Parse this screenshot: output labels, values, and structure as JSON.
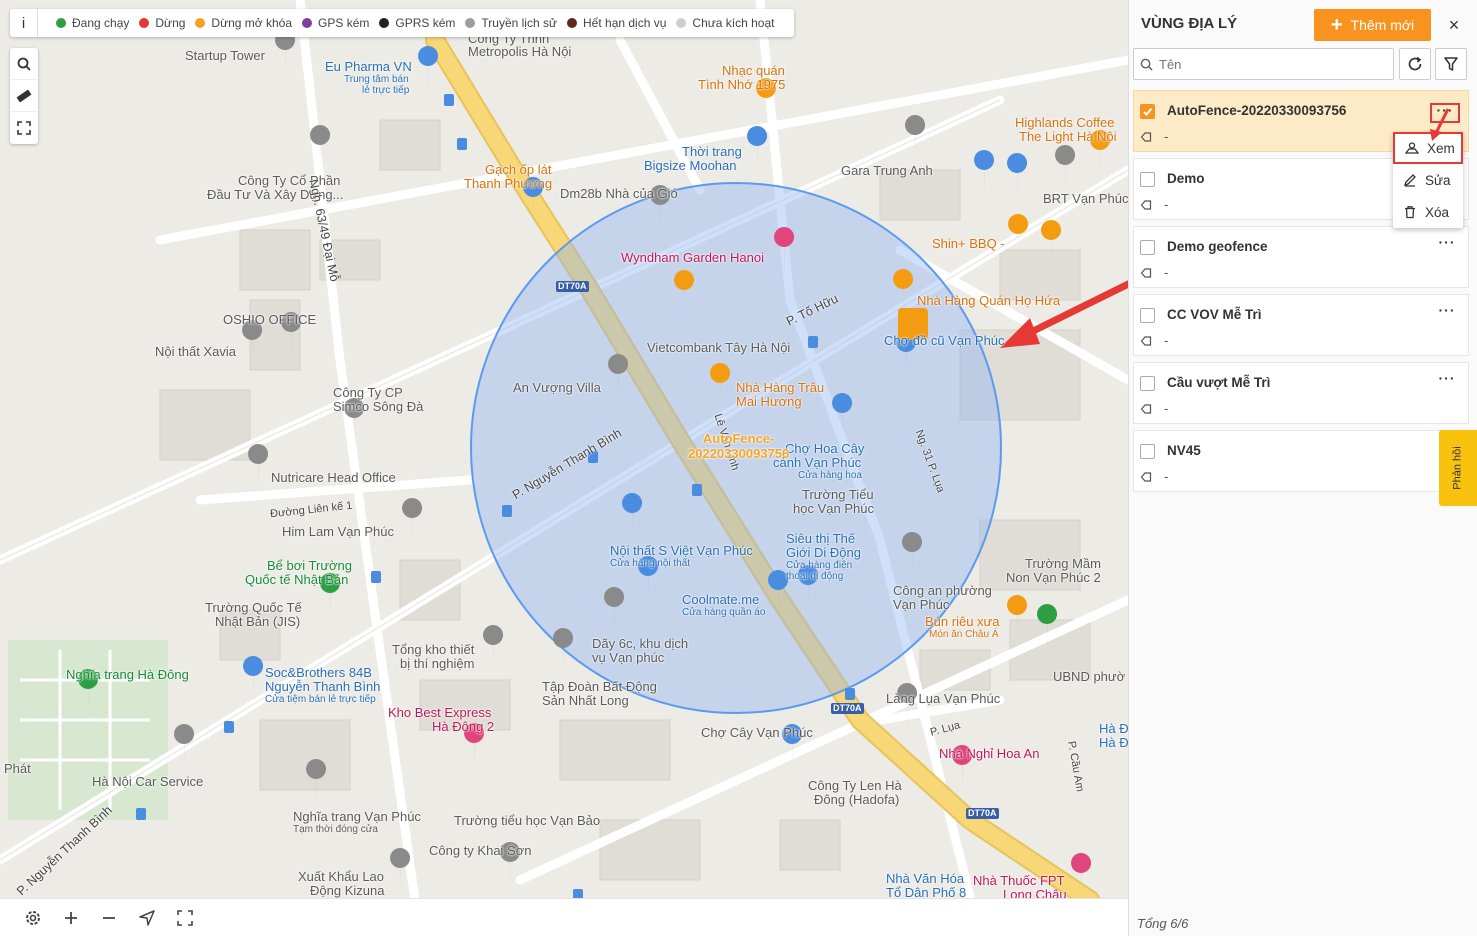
{
  "legend": {
    "info_label": "i",
    "items": [
      {
        "label": "Đang chạy",
        "color": "#2e9e44"
      },
      {
        "label": "Dừng",
        "color": "#e53935"
      },
      {
        "label": "Dừng mở khóa",
        "color": "#f7a21e"
      },
      {
        "label": "GPS kém",
        "color": "#7b3f9e"
      },
      {
        "label": "GPRS kém",
        "color": "#222222"
      },
      {
        "label": "Truyền lịch sử",
        "color": "#9e9e9e"
      },
      {
        "label": "Hết hạn dịch vụ",
        "color": "#5d2a1a"
      },
      {
        "label": "Chưa kích hoạt",
        "color": "#cfcfcf"
      }
    ]
  },
  "map": {
    "geofence_label_line1": "AutoFence-",
    "geofence_label_line2": "20220330093756",
    "labels": {
      "startup_tower": "Startup Tower",
      "congty_tnhh": "Công Ty Tnhh",
      "metropolis": "Metropolis Hà Nội",
      "eupharma": "Eu Pharma VN",
      "eupharma_sub1": "Trung tâm bán",
      "eupharma_sub2": "lẻ trực tiếp",
      "nhacquan1": "Nhạc quán",
      "nhacquan2": "Tình Nhớ 1975",
      "highlands1": "Highlands Coffee",
      "highlands2": "The Light Hà Nội",
      "congty_cp1": "Công Ty Cổ Phần",
      "congty_cp2": "Đầu Tư Và Xây Dựng...",
      "ngo": "Ngh. 63/49 Đại Mỗ",
      "gachoplat1": "Gạch ốp lát",
      "gachoplat2": "Thanh Phương",
      "thoitrang1": "Thời trang",
      "thoitrang2": "Bigsize Moohan",
      "dm28b": "Dm28b Nhà của Gió",
      "gara": "Gara Trung Anh",
      "brt": "BRT Vạn Phúc",
      "wyndham": "Wyndham Garden Hanoi",
      "shin": "Shin+ BBQ -",
      "oshio": "OSHIO OFFICE",
      "noithat_xavia": "Nội thất Xavia",
      "to_huu": "P. Tố Hữu",
      "nhahang_quan1": "Nhà Hàng Quán Họ Hứa",
      "cho_vanphuc": "Chợ đồ cũ Vạn Phúc",
      "vietcombank": "Vietcombank Tây Hà Nội",
      "congty_simco1": "Công Ty CP",
      "congty_simco2": "Simco Sông Đà",
      "anvuong": "An Vượng Villa",
      "tratrau1": "Nhà Hàng Trâu",
      "tratrau2": "Mai Hương",
      "nguyenthanhbinh": "P. Nguyễn Thanh Bình",
      "levan": "Lê Văn Linh",
      "chohoacay1": "Chợ Hoa Cây",
      "chohoacay2": "cảnh Vạn Phúc",
      "chohoacay3": "Cửa hàng hoa",
      "ng31": "Ng. 31 P. Lụa",
      "nutricare": "Nutricare Head Office",
      "duonglienke": "Đường Liên kế 1",
      "himlam": "Him Lam Vạn Phúc",
      "truongtieuhoc1": "Trường Tiểu",
      "truongtieuhoc2": "học Vạn Phúc",
      "beboi1": "Bể bơi Trường",
      "beboi2": "Quốc tế Nhật Bản",
      "truongqt1": "Trường Quốc Tế",
      "truongqt2": "Nhật Bản (JIS)",
      "noithat_s1": "Nội thất S Việt Vạn Phúc",
      "noithat_s2": "Cửa hàng nội thất",
      "sieuthi1": "Siêu thị Thế",
      "sieuthi2": "Giới Di Động",
      "sieuthi3": "Cửa hàng điện",
      "sieuthi4": "thoại di động",
      "truongmam1": "Trường Mầm",
      "truongmam2": "Non Vạn Phúc 2",
      "coolmate1": "Coolmate.me",
      "coolmate2": "Cửa hàng quần áo",
      "congan1": "Công an phường",
      "congan2": "Vạn Phúc",
      "bunrieu1": "Bún riêu xưa",
      "bunrieu2": "Món ăn Châu Á",
      "tongkho1": "Tổng kho thiết",
      "tongkho2": "bị thí nghiệm",
      "day6c1": "Dãy 6c, khu dịch",
      "day6c2": "vụ Vạn phúc",
      "ubnd": "UBND phườ",
      "nghiatrang_hd": "Nghĩa trang Hà Đông",
      "soc1": "Soc&Brothers 84B",
      "soc2": "Nguyễn Thanh Bình",
      "soc3": "Cửa tiệm bán lẻ trực tiếp",
      "taphoan1": "Tập Đoàn Bất Động",
      "taphoan2": "Sản Nhất Long",
      "langlua": "Làng Lụa Vạn Phúc",
      "kho_best1": "Kho Best Express",
      "kho_best2": "Hà Đông 2",
      "p_lua": "P. Lụa",
      "chocay": "Chợ Cây Vạn Phúc",
      "nhanghi": "Nhà Nghỉ Hoa An",
      "p_cauam": "P. Cầu Am",
      "hanoicar": "Hà Nội Car Service",
      "phat": "Phát",
      "congty_len1": "Công Ty Len Hà",
      "congty_len2": "Đông (Hadofa)",
      "nghiatrang_vp1": "Nghĩa trang Vạn Phúc",
      "nghiatrang_vp2": "Tạm thời đóng cửa",
      "truong_vb": "Trường tiểu học Vạn Bảo",
      "congty_ks": "Công ty Khai Sơn",
      "p_ntb2": "P. Nguyễn Thanh Bình",
      "xuatkhau1": "Xuất Khẩu Lao",
      "xuatkhau2": "Động Kizuna",
      "nhavanhoa1": "Nhà Văn Hóa",
      "nhavanhoa2": "Tổ Dân Phố 8",
      "nhathuoc1": "Nhà Thuốc FPT",
      "nhathuoc2": "Long Châu",
      "ha_d1": "Hà Đ",
      "ha_d2": "Hà Đ",
      "dt70a": "DT70A"
    }
  },
  "panel": {
    "title": "VÙNG ĐỊA LÝ",
    "add_label": "Thêm mới",
    "close_label": "×",
    "search_placeholder": "Tên",
    "rows": [
      {
        "name": "AutoFence-20220330093756",
        "desc": "-",
        "more": "···"
      },
      {
        "name": "Demo",
        "desc": "-",
        "more": "···"
      },
      {
        "name": "Demo geofence",
        "desc": "-",
        "more": "···"
      },
      {
        "name": "CC VOV Mễ Trì",
        "desc": "-",
        "more": "···"
      },
      {
        "name": "Cầu vượt Mễ Trì",
        "desc": "-",
        "more": "···"
      },
      {
        "name": "NV45",
        "desc": "-",
        "more": ""
      }
    ],
    "menu": {
      "view": "Xem",
      "edit": "Sửa",
      "delete": "Xóa"
    },
    "feedback": "Phản hồi",
    "footer": "Tổng 6/6"
  },
  "colors": {
    "accent": "#f7931e",
    "geofence_fill": "#8fb4f2",
    "geofence_stroke": "#5b9bef",
    "highlight": "#e53935",
    "road": "#f5d26b"
  }
}
